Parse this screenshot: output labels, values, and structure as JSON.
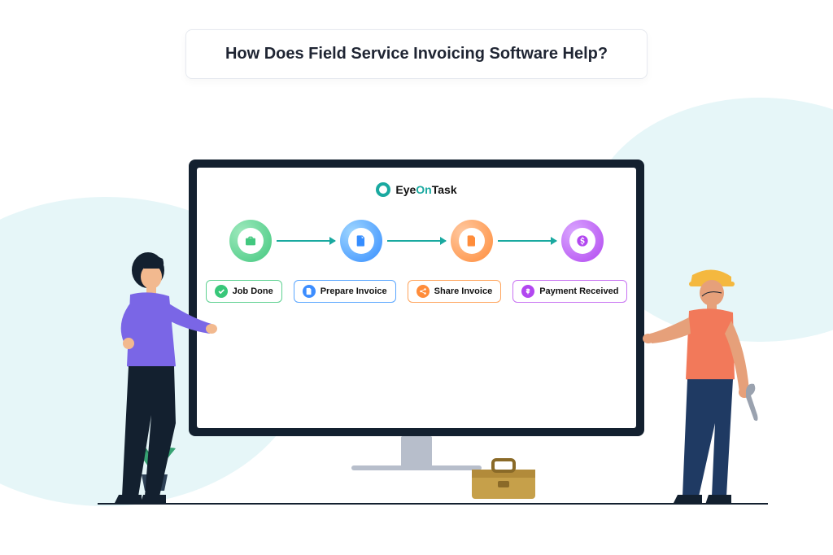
{
  "title": "How Does Field Service Invoicing Software Help?",
  "brand": {
    "name_left": "Eye",
    "name_mid": "On",
    "name_right": "Task"
  },
  "steps": [
    {
      "id": "job-done",
      "label": "Job Done",
      "color": "green",
      "icon": "briefcase"
    },
    {
      "id": "prepare-invoice",
      "label": "Prepare Invoice",
      "color": "blue",
      "icon": "document"
    },
    {
      "id": "share-invoice",
      "label": "Share Invoice",
      "color": "orange",
      "icon": "share"
    },
    {
      "id": "payment-received",
      "label": "Payment Received",
      "color": "purple",
      "icon": "dollar"
    }
  ],
  "colors": {
    "accent": "#1aa9a0",
    "green": "#43c87f",
    "blue": "#358dff",
    "orange": "#ff8c3a",
    "purple": "#b247f0"
  }
}
